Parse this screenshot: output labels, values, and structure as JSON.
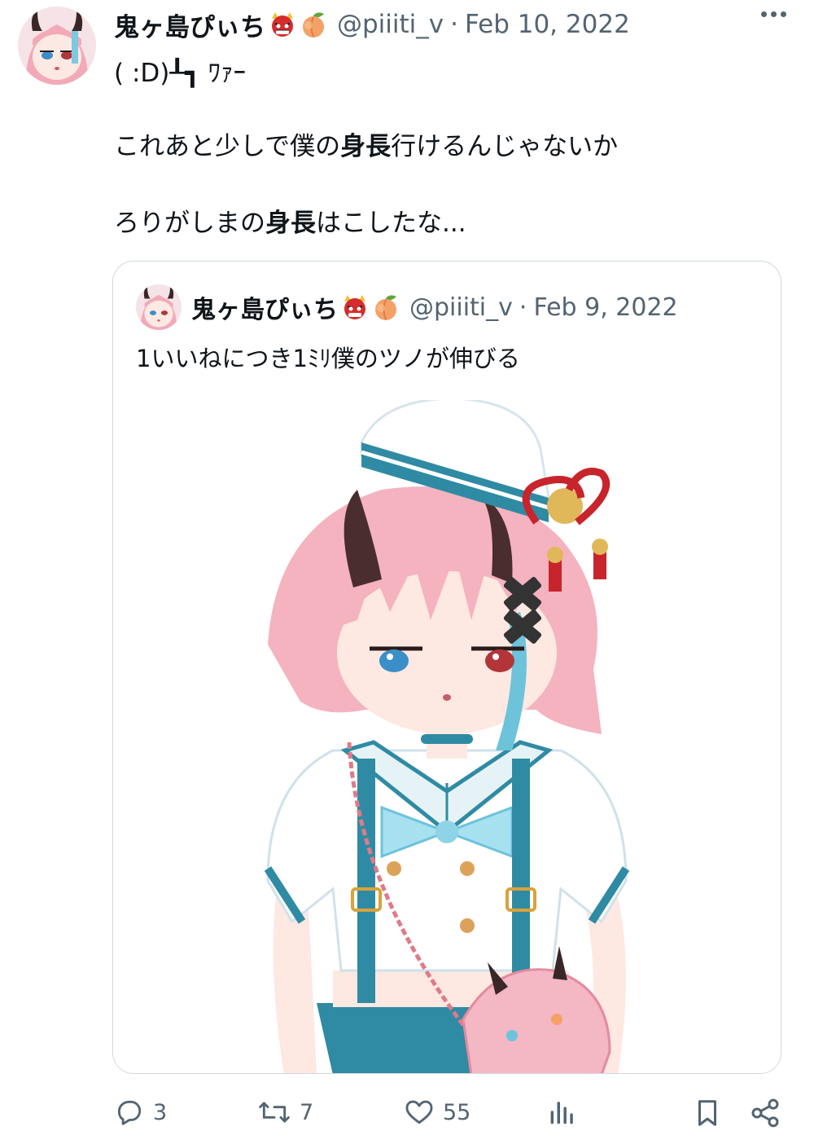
{
  "tweet": {
    "author_name": "鬼ヶ島ぴぃち",
    "handle": "@piiiti_v",
    "separator": "·",
    "date": "Feb 10, 2022",
    "name_emoji_1": "ogre-icon",
    "name_emoji_2": "peach-icon",
    "line1": "( :D)┸┓ ﾜｧｰ",
    "line2": {
      "pre": "これあと少しで僕の",
      "bold": "身長",
      "post": "行けるんじゃないか"
    },
    "line3": {
      "pre": "ろりがしまの",
      "bold": "身長",
      "post": "はこしたな..."
    }
  },
  "quoted": {
    "author_name": "鬼ヶ島ぴぃち",
    "handle": "@piiiti_v",
    "separator": "·",
    "date": "Feb 9, 2022",
    "text": "1いいねにつき1ﾐﾘ僕のツノが伸びる",
    "image": "anime-character-illustration"
  },
  "actions": {
    "replies": "3",
    "retweets": "7",
    "likes": "55"
  },
  "colors": {
    "text": "#0f1419",
    "muted": "#536471",
    "border": "#cfd9de",
    "hair_pink": "#f4b3bf",
    "accent_teal": "#2d8fa8"
  }
}
